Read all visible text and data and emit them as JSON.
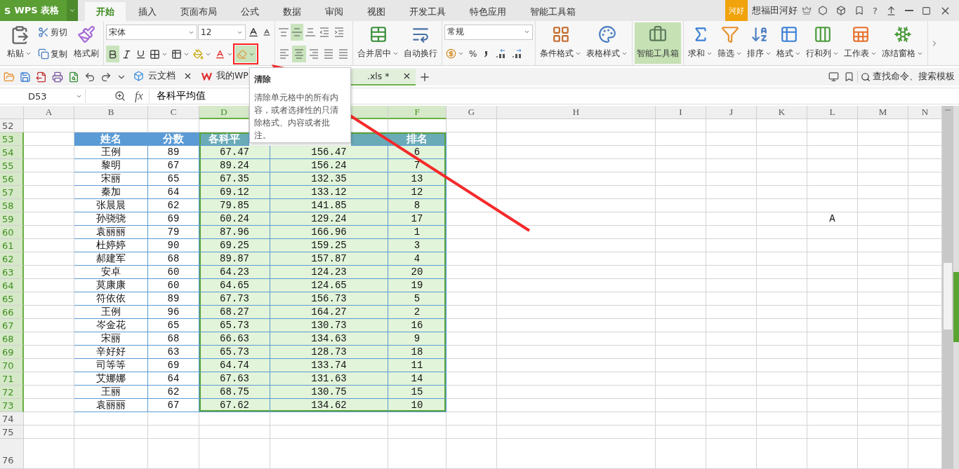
{
  "app": {
    "logo": "S",
    "name": "WPS 表格"
  },
  "menu_tabs": [
    {
      "label": "开始",
      "selected": true
    },
    {
      "label": "插入",
      "selected": false
    },
    {
      "label": "页面布局",
      "selected": false
    },
    {
      "label": "公式",
      "selected": false
    },
    {
      "label": "数据",
      "selected": false
    },
    {
      "label": "审阅",
      "selected": false
    },
    {
      "label": "视图",
      "selected": false
    },
    {
      "label": "开发工具",
      "selected": false
    },
    {
      "label": "特色应用",
      "selected": false
    },
    {
      "label": "智能工具箱",
      "selected": false
    }
  ],
  "account": {
    "badge": "河好",
    "user": "想福田河好",
    "help": "?"
  },
  "ribbon": {
    "paste": "粘贴",
    "cut": "剪切",
    "copy": "复制",
    "format_painter": "格式刷",
    "font": {
      "name": "宋体",
      "size": "12",
      "bold": true,
      "italic": false,
      "underline": false
    },
    "clear_tool": {
      "highlighted": true
    },
    "vertical_align": [
      {
        "selected": false
      },
      {
        "selected": true
      },
      {
        "selected": false
      }
    ],
    "horizontal_align": [
      {
        "selected": false
      },
      {
        "selected": true
      },
      {
        "selected": false
      },
      {
        "selected": false
      },
      {
        "selected": false
      }
    ],
    "number_format": "常规",
    "percent": "%",
    "large_buttons": [
      {
        "label": "合并居中",
        "dropdown": true,
        "highlighted": false
      },
      {
        "label": "自动换行",
        "dropdown": false,
        "highlighted": false
      },
      {
        "label": "条件格式",
        "dropdown": true,
        "highlighted": false
      },
      {
        "label": "表格样式",
        "dropdown": true,
        "highlighted": false
      },
      {
        "label": "智能工具箱",
        "dropdown": false,
        "highlighted": true
      },
      {
        "label": "求和",
        "dropdown": true,
        "highlighted": false
      },
      {
        "label": "筛选",
        "dropdown": true,
        "highlighted": false
      },
      {
        "label": "排序",
        "dropdown": true,
        "highlighted": false
      },
      {
        "label": "格式",
        "dropdown": true,
        "highlighted": false
      },
      {
        "label": "行和列",
        "dropdown": true,
        "highlighted": false
      },
      {
        "label": "工作表",
        "dropdown": true,
        "highlighted": false
      },
      {
        "label": "冻结窗格",
        "dropdown": true,
        "highlighted": false
      }
    ]
  },
  "doc_tabs": [
    {
      "label": "云文档",
      "selected": false,
      "closable": true
    },
    {
      "label": "我的WP",
      "selected": false
    },
    {
      "label": ".xls *",
      "selected": true,
      "closable": true
    }
  ],
  "search": "查找命令、搜索模板",
  "formula_bar": {
    "cell": "D53",
    "fx": "fx",
    "value": "各科平均值"
  },
  "tooltip": {
    "title": "清除",
    "body": "清除单元格中的所有内容，或者选择性的只清除格式、内容或者批注。"
  },
  "sheet": {
    "columns": [
      {
        "label": "A",
        "selected": false
      },
      {
        "label": "B",
        "selected": false
      },
      {
        "label": "C",
        "selected": false
      },
      {
        "label": "D",
        "selected": true
      },
      {
        "selected": true
      },
      {
        "label": "F",
        "selected": true
      },
      {
        "label": "G",
        "selected": false
      },
      {
        "label": "H",
        "selected": false
      },
      {
        "label": "I",
        "selected": false
      },
      {
        "label": "J",
        "selected": false
      },
      {
        "label": "K",
        "selected": false
      },
      {
        "label": "L",
        "selected": false
      },
      {
        "label": "M",
        "selected": false
      },
      {
        "label": "N",
        "selected": false
      }
    ],
    "rows": [
      {
        "number": "52",
        "kind": "blank",
        "selected": false
      },
      {
        "number": "53",
        "kind": "header",
        "selected": true,
        "cells": {
          "B": "姓名",
          "C": "分数",
          "D": "各科平",
          "F": "排名"
        }
      },
      {
        "number": "54",
        "kind": "data",
        "selected": true,
        "cells": {
          "B": "王例",
          "C": "89",
          "D": "67.47",
          "E": "156.47",
          "F": "6"
        }
      },
      {
        "number": "55",
        "kind": "data",
        "selected": true,
        "cells": {
          "B": "黎明",
          "C": "67",
          "D": "89.24",
          "E": "156.24",
          "F": "7"
        }
      },
      {
        "number": "56",
        "kind": "data",
        "selected": true,
        "cells": {
          "B": "宋丽",
          "C": "65",
          "D": "67.35",
          "E": "132.35",
          "F": "13"
        }
      },
      {
        "number": "57",
        "kind": "data",
        "selected": true,
        "cells": {
          "B": "秦加",
          "C": "64",
          "D": "69.12",
          "E": "133.12",
          "F": "12"
        }
      },
      {
        "number": "58",
        "kind": "data",
        "selected": true,
        "cells": {
          "B": "张晨晨",
          "C": "62",
          "D": "79.85",
          "E": "141.85",
          "F": "8"
        }
      },
      {
        "number": "59",
        "kind": "data",
        "selected": true,
        "cells": {
          "B": "孙骁骁",
          "C": "69",
          "D": "60.24",
          "E": "129.24",
          "F": "17",
          "L": "A"
        }
      },
      {
        "number": "60",
        "kind": "data",
        "selected": true,
        "cells": {
          "B": "袁丽丽",
          "C": "79",
          "D": "87.96",
          "E": "166.96",
          "F": "1"
        }
      },
      {
        "number": "61",
        "kind": "data",
        "selected": true,
        "cells": {
          "B": "杜婷婷",
          "C": "90",
          "D": "69.25",
          "E": "159.25",
          "F": "3"
        }
      },
      {
        "number": "62",
        "kind": "data",
        "selected": true,
        "cells": {
          "B": "郝建军",
          "C": "68",
          "D": "89.87",
          "E": "157.87",
          "F": "4"
        }
      },
      {
        "number": "63",
        "kind": "data",
        "selected": true,
        "cells": {
          "B": "安卓",
          "C": "60",
          "D": "64.23",
          "E": "124.23",
          "F": "20"
        }
      },
      {
        "number": "64",
        "kind": "data",
        "selected": true,
        "cells": {
          "B": "莫康康",
          "C": "60",
          "D": "64.65",
          "E": "124.65",
          "F": "19"
        }
      },
      {
        "number": "65",
        "kind": "data",
        "selected": true,
        "cells": {
          "B": "符依依",
          "C": "89",
          "D": "67.73",
          "E": "156.73",
          "F": "5"
        }
      },
      {
        "number": "66",
        "kind": "data",
        "selected": true,
        "cells": {
          "B": "王例",
          "C": "96",
          "D": "68.27",
          "E": "164.27",
          "F": "2"
        }
      },
      {
        "number": "67",
        "kind": "data",
        "selected": true,
        "cells": {
          "B": "岑金花",
          "C": "65",
          "D": "65.73",
          "E": "130.73",
          "F": "16"
        }
      },
      {
        "number": "68",
        "kind": "data",
        "selected": true,
        "cells": {
          "B": "宋丽",
          "C": "68",
          "D": "66.63",
          "E": "134.63",
          "F": "9"
        }
      },
      {
        "number": "69",
        "kind": "data",
        "selected": true,
        "cells": {
          "B": "辛好好",
          "C": "63",
          "D": "65.73",
          "E": "128.73",
          "F": "18"
        }
      },
      {
        "number": "70",
        "kind": "data",
        "selected": true,
        "cells": {
          "B": "司等等",
          "C": "69",
          "D": "64.74",
          "E": "133.74",
          "F": "11"
        }
      },
      {
        "number": "71",
        "kind": "data",
        "selected": true,
        "cells": {
          "B": "艾娜娜",
          "C": "64",
          "D": "67.63",
          "E": "131.63",
          "F": "14"
        }
      },
      {
        "number": "72",
        "kind": "data",
        "selected": true,
        "cells": {
          "B": "王丽",
          "C": "62",
          "D": "68.75",
          "E": "130.75",
          "F": "15"
        }
      },
      {
        "number": "73",
        "kind": "data",
        "selected": true,
        "cells": {
          "B": "袁丽丽",
          "C": "67",
          "D": "67.62",
          "E": "134.62",
          "F": "10"
        }
      },
      {
        "number": "74",
        "kind": "blank",
        "selected": false
      },
      {
        "number": "75",
        "kind": "blank",
        "selected": false
      },
      {
        "number": "76",
        "kind": "blank",
        "selected": false
      }
    ]
  }
}
